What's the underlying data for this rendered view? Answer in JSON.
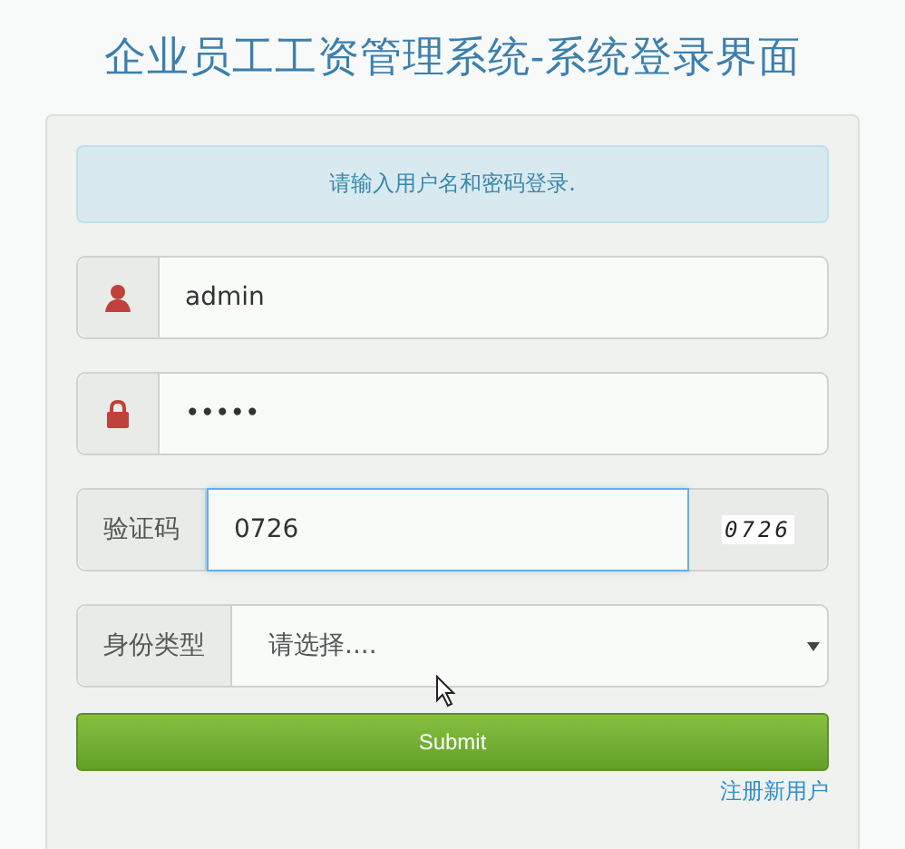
{
  "title": "企业员工工资管理系统-系统登录界面",
  "alert": "请输入用户名和密码登录.",
  "fields": [
    {
      "kind": "username",
      "value": "admin",
      "focused": false
    },
    {
      "kind": "password",
      "value": "•••••",
      "focused": false
    },
    {
      "kind": "captcha",
      "label": "验证码",
      "value": "0726",
      "captcha": "0726",
      "focused": true
    },
    {
      "kind": "select",
      "label": "身份类型",
      "placeholder": "请选择....",
      "focused": false
    }
  ],
  "submit": "Submit",
  "register_link": "注册新用户"
}
